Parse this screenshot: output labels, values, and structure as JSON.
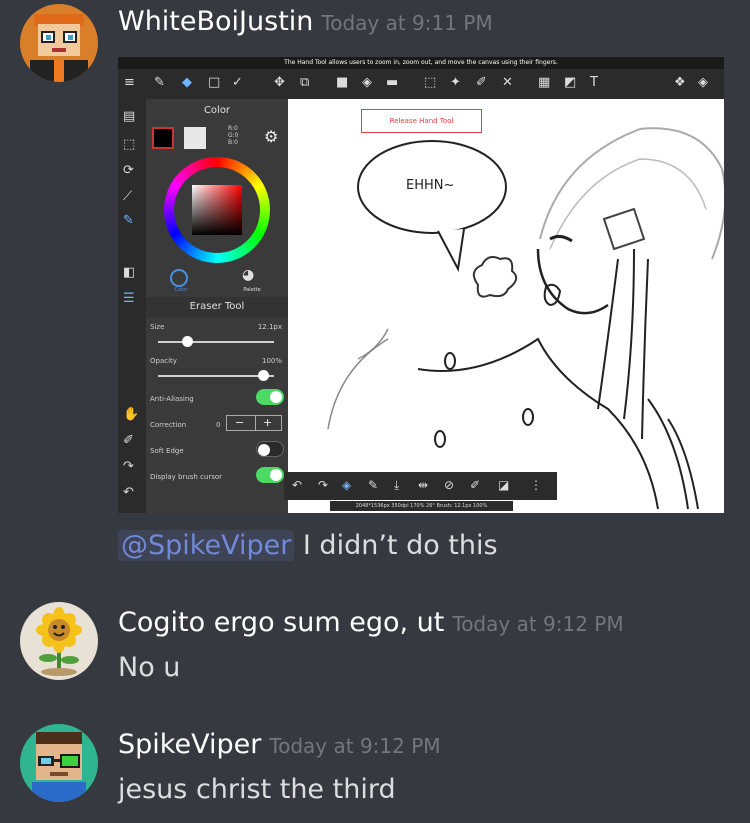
{
  "messages": [
    {
      "username": "WhiteBoiJustin",
      "timestamp": "Today at 9:11 PM",
      "mention": "@SpikeViper",
      "text": " I didn’t do this"
    },
    {
      "username": "Cogito ergo sum ego, ut",
      "timestamp": "Today at 9:12 PM",
      "text": "No u"
    },
    {
      "username": "SpikeViper",
      "timestamp": "Today at 9:12 PM",
      "text": "jesus christ the third"
    }
  ],
  "attachment": {
    "notice": "The Hand Tool allows users to zoom in, zoom out, and move the canvas using their fingers.",
    "color_panel_title": "Color",
    "rgb": "R:0\nG:0\nB:0",
    "tab_color": "Color",
    "tab_palette": "Palette",
    "tool_title": "Eraser Tool",
    "size_label": "Size",
    "size_value": "12.1px",
    "opacity_label": "Opacity",
    "opacity_value": "100%",
    "antialias_label": "Anti-Aliasing",
    "correction_label": "Correction",
    "correction_value": "0",
    "softedge_label": "Soft Edge",
    "cursor_label": "Display brush cursor",
    "release_button": "Release Hand Tool",
    "speech_text": "EHHN~",
    "status_text": "2048*1536px 350dpi 170% 26° Brush: 12.1px 100%"
  },
  "colors": {
    "background": "#36393f",
    "username": "#ffffff",
    "timestamp": "#72767d",
    "mention": "#7289da",
    "toggle_on": "#4cd964"
  }
}
